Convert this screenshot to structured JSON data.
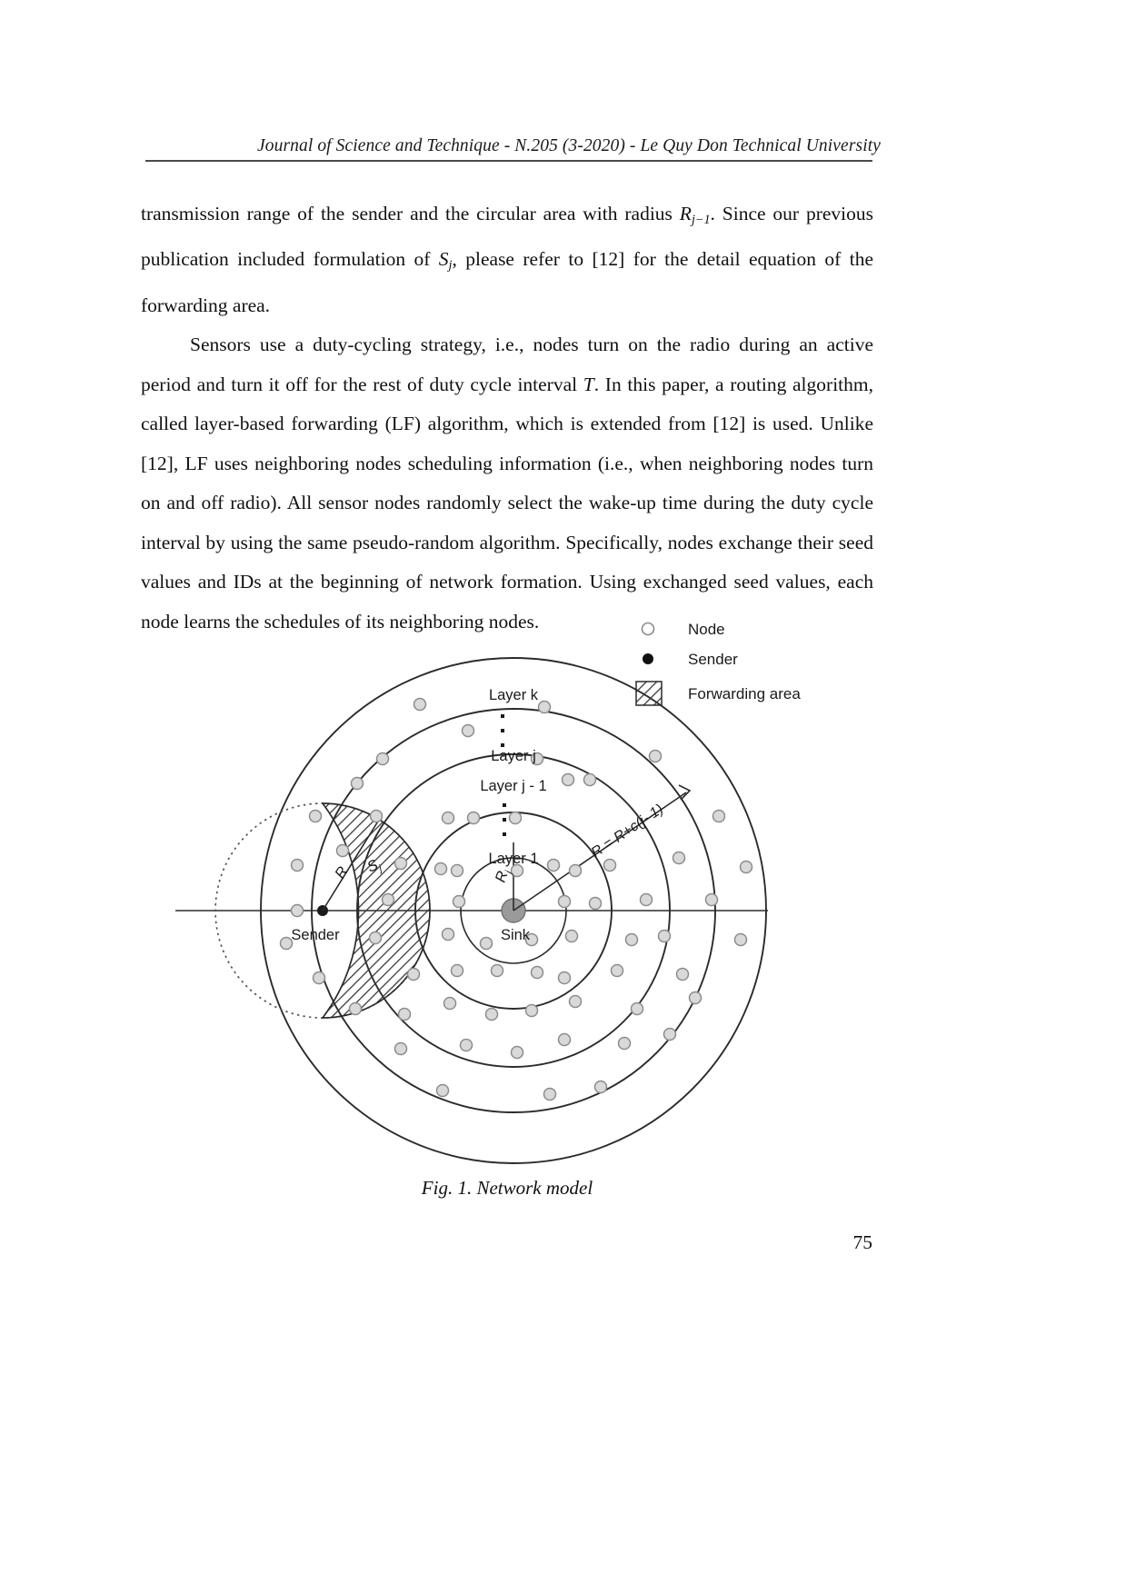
{
  "header": {
    "running_head": "Journal of Science and Technique - N.205 (3-2020) - Le Quy Don Technical University"
  },
  "body": {
    "paragraph1": {
      "seg1": "transmission range of the sender and the circular area with radius ",
      "math1": "R",
      "math1_sub": "j−1",
      "seg2": ". Since our previous publication included formulation of ",
      "math2": "S",
      "math2_sub": "j",
      "seg3": ", please refer to [12] for the detail equation of the forwarding area."
    },
    "paragraph2": {
      "seg1": "Sensors use a duty-cycling strategy, i.e., nodes turn on the radio during an active period and turn it off for the rest of duty cycle interval ",
      "math1": "T",
      "seg2": ". In this paper, a routing algorithm, called layer-based forwarding (LF) algorithm, which is extended from [12] is used. Unlike [12], LF uses neighboring nodes scheduling information (i.e., when neighboring nodes turn on and off radio). All sensor nodes randomly select the wake-up time during the duty cycle interval by using the same pseudo-random algorithm. Specifically, nodes exchange their seed values and IDs at the beginning of network formation. Using exchanged seed values, each node learns the schedules of its neighboring nodes."
    }
  },
  "figure": {
    "caption": "Fig. 1. Network model",
    "legend": {
      "items": [
        {
          "label": "Node",
          "marker": "open-circle"
        },
        {
          "label": "Sender",
          "marker": "filled-circle"
        },
        {
          "label": "Forwarding area",
          "marker": "hatched-square"
        }
      ]
    },
    "labels": {
      "layer_k": "Layer k",
      "layer_j": "Layer j",
      "layer_j_minus_1": "Layer j - 1",
      "layer_1": "Layer 1",
      "sink": "Sink",
      "sender": "Sender",
      "radius_R": "R",
      "radius_Rj": "R",
      "radius_Rj_sub": "j",
      "radius_formula": "R = R+c(j- 1)",
      "forwarding_area_S": "S",
      "forwarding_area_S_sub": "j"
    },
    "colors": {
      "line": "#2b2b2b",
      "node_fill": "#d9d9d9",
      "node_stroke": "#8c8c8c",
      "sink_fill": "#9a9a9a",
      "hatch": "#3a3a3a"
    }
  },
  "footer": {
    "page_number": "75"
  }
}
